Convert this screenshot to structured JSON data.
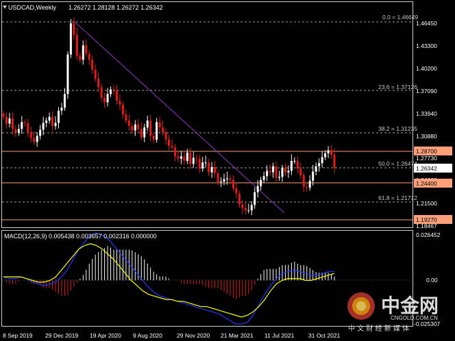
{
  "header": {
    "symbol": "USDCAD,Weekly",
    "ohlc": "1.26272 1.28128 1.26272 1.26342"
  },
  "indicator": {
    "label": "MACD(12,26,9) 0.005438 0.003657 0.002316 0.000000"
  },
  "price_axis": {
    "ticks": [
      "1.46450",
      "1.43300",
      "1.40200",
      "1.37090",
      "1.33940",
      "1.30880",
      "1.27730",
      "1.24600",
      "1.21500",
      "1.18467"
    ]
  },
  "macd_axis": {
    "ticks": [
      "0.026452",
      "0.00",
      "-0.025307"
    ]
  },
  "time_axis": {
    "ticks": [
      "8 Sep 2019",
      "29 Dec 2019",
      "19 Apr 2020",
      "9 Aug 2020",
      "29 Nov 2020",
      "21 Mar 2021",
      "11 Jul 2021",
      "31 Oct 2021"
    ]
  },
  "fib_levels": [
    {
      "label": "0.0 = 1.46649",
      "value": 1.46649
    },
    {
      "label": "23.6 = 1.37126",
      "value": 1.37126
    },
    {
      "label": "38.2 = 1.31235",
      "value": 1.31235
    },
    {
      "label": "50.0 = 1.26474",
      "value": 1.26474
    },
    {
      "label": "61.8 = 1.21712",
      "value": 1.21712
    }
  ],
  "price_tags": [
    {
      "text": "1.28700",
      "value": 1.287,
      "color": "#ffa07a"
    },
    {
      "text": "1.26342",
      "value": 1.26342,
      "color": "#ffffff"
    },
    {
      "text": "1.24400",
      "value": 1.244,
      "color": "#ffa07a"
    },
    {
      "text": "1.19270",
      "value": 1.1927,
      "color": "#ffa07a"
    }
  ],
  "watermark": {
    "brand": "中金网",
    "tagline": "中 文 财 经 新 媒 体",
    "url": "CNGOLD.COM.CN"
  },
  "colors": {
    "background": "#000000",
    "bull": "#ffffff",
    "bear": "#e21b1b",
    "trendline": "#9932cc",
    "resistance": "#ffa07a",
    "signal": "#ffff00",
    "macd_line": "#1e3cff",
    "grid": "#888888"
  },
  "chart_data": {
    "type": "candlestick",
    "title": "USDCAD,Weekly",
    "y_range": [
      1.18467,
      1.48
    ],
    "close_series": [
      1.33,
      1.321,
      1.328,
      1.314,
      1.309,
      1.314,
      1.323,
      1.322,
      1.31,
      1.302,
      1.297,
      1.305,
      1.313,
      1.322,
      1.325,
      1.33,
      1.318,
      1.322,
      1.338,
      1.342,
      1.36,
      1.412,
      1.453,
      1.438,
      1.41,
      1.405,
      1.424,
      1.413,
      1.405,
      1.392,
      1.38,
      1.369,
      1.355,
      1.349,
      1.36,
      1.366,
      1.365,
      1.351,
      1.346,
      1.333,
      1.325,
      1.318,
      1.312,
      1.32,
      1.314,
      1.303,
      1.316,
      1.325,
      1.305,
      1.3,
      1.323,
      1.316,
      1.31,
      1.3,
      1.292,
      1.29,
      1.278,
      1.275,
      1.278,
      1.272,
      1.283,
      1.268,
      1.276,
      1.275,
      1.262,
      1.27,
      1.27,
      1.257,
      1.264,
      1.256,
      1.244,
      1.245,
      1.248,
      1.249,
      1.247,
      1.236,
      1.229,
      1.215,
      1.21,
      1.207,
      1.207,
      1.214,
      1.231,
      1.239,
      1.247,
      1.252,
      1.259,
      1.257,
      1.265,
      1.25,
      1.251,
      1.263,
      1.257,
      1.259,
      1.272,
      1.272,
      1.262,
      1.253,
      1.238,
      1.237,
      1.246,
      1.258,
      1.265,
      1.269,
      1.277,
      1.282,
      1.286,
      1.28,
      1.263
    ],
    "macd_series": [
      {
        "name": "MACD",
        "values": [
          0.002,
          0.001,
          0.001,
          0.002,
          0.001,
          -0.001,
          -0.002,
          -0.003,
          -0.002,
          -0.001,
          0.002,
          0.006,
          0.012,
          0.018,
          0.022,
          0.026,
          0.027,
          0.026,
          0.024,
          0.02,
          0.016,
          0.012,
          0.008,
          0.004,
          0.0,
          -0.004,
          -0.007,
          -0.009,
          -0.01,
          -0.011,
          -0.012,
          -0.013,
          -0.014,
          -0.015,
          -0.016,
          -0.017,
          -0.018,
          -0.019,
          -0.021,
          -0.023,
          -0.025,
          -0.025,
          -0.024,
          -0.02,
          -0.014,
          -0.008,
          -0.003,
          0.001,
          0.004,
          0.005,
          0.006,
          0.005,
          0.004,
          0.003,
          0.003,
          0.004,
          0.005,
          0.005
        ]
      },
      {
        "name": "Signal",
        "values": [
          0.002,
          0.002,
          0.002,
          0.002,
          0.001,
          0.0,
          -0.001,
          -0.001,
          0.0,
          0.002,
          0.006,
          0.01,
          0.014,
          0.018,
          0.02,
          0.021,
          0.02,
          0.018,
          0.015,
          0.012,
          0.008,
          0.004,
          0.0,
          -0.003,
          -0.006,
          -0.008,
          -0.009,
          -0.01,
          -0.011,
          -0.011,
          -0.012,
          -0.012,
          -0.013,
          -0.014,
          -0.015,
          -0.015,
          -0.016,
          -0.017,
          -0.018,
          -0.019,
          -0.02,
          -0.021,
          -0.02,
          -0.018,
          -0.015,
          -0.011,
          -0.006,
          -0.002,
          0.0,
          0.001,
          0.001,
          0.001,
          0.0,
          0.0,
          0.001,
          0.002,
          0.003,
          0.004
        ]
      }
    ]
  }
}
